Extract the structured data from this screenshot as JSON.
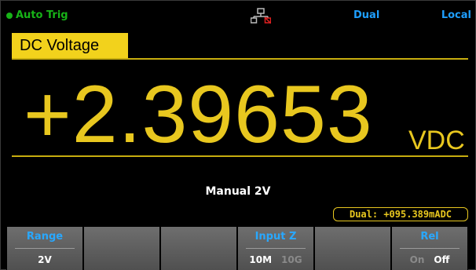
{
  "status": {
    "trigger": "Auto Trig",
    "dual": "Dual",
    "local": "Local"
  },
  "function": "DC Voltage",
  "reading": {
    "value": "+2.39653",
    "unit": "VDC"
  },
  "range_info": "Manual 2V",
  "dual_readout": "Dual: +095.389mADC",
  "softkeys": [
    {
      "title": "Range",
      "value": "2V"
    },
    {
      "title": "",
      "value": ""
    },
    {
      "title": "",
      "value": ""
    },
    {
      "title": "Input Z",
      "options": [
        "10M",
        "10G"
      ],
      "selected": "10M"
    },
    {
      "title": "",
      "value": ""
    },
    {
      "title": "Rel",
      "options": [
        "On",
        "Off"
      ],
      "selected": "Off"
    }
  ],
  "colors": {
    "accent_yellow": "#e8c71f",
    "status_blue": "#1e9fff",
    "trigger_green": "#17b317"
  },
  "icons": {
    "network": "network-icon"
  }
}
